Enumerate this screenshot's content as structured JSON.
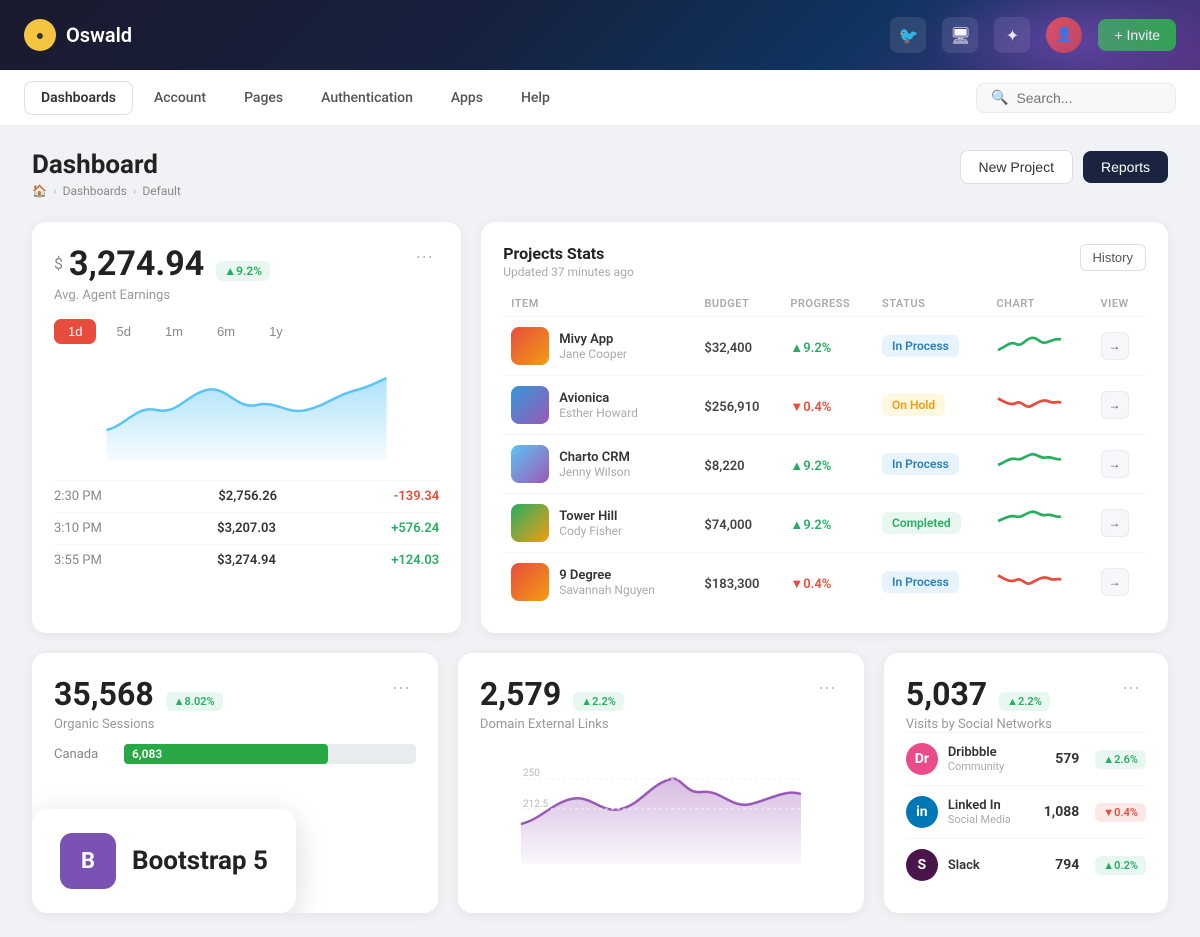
{
  "topbar": {
    "logo_icon": "●",
    "logo_text": "Oswald",
    "invite_label": "+ Invite"
  },
  "navbar": {
    "items": [
      {
        "label": "Dashboards",
        "active": true
      },
      {
        "label": "Account",
        "active": false
      },
      {
        "label": "Pages",
        "active": false
      },
      {
        "label": "Authentication",
        "active": false
      },
      {
        "label": "Apps",
        "active": false
      },
      {
        "label": "Help",
        "active": false
      }
    ],
    "search_placeholder": "Search..."
  },
  "page": {
    "title": "Dashboard",
    "breadcrumb": [
      "🏠",
      "Dashboards",
      "Default"
    ],
    "new_project_btn": "New Project",
    "reports_btn": "Reports"
  },
  "earnings": {
    "currency": "$",
    "amount": "3,274.94",
    "badge": "▲9.2%",
    "label": "Avg. Agent Earnings",
    "filters": [
      "1d",
      "5d",
      "1m",
      "6m",
      "1y"
    ],
    "active_filter": "1d",
    "rows": [
      {
        "time": "2:30 PM",
        "value": "$2,756.26",
        "change": "-139.34",
        "positive": false
      },
      {
        "time": "3:10 PM",
        "value": "$3,207.03",
        "change": "+576.24",
        "positive": true
      },
      {
        "time": "3:55 PM",
        "value": "$3,274.94",
        "change": "+124.03",
        "positive": true
      }
    ]
  },
  "projects": {
    "title": "Projects Stats",
    "updated": "Updated 37 minutes ago",
    "history_btn": "History",
    "columns": [
      "Item",
      "Budget",
      "Progress",
      "Status",
      "Chart",
      "View"
    ],
    "rows": [
      {
        "name": "Mivy App",
        "person": "Jane Cooper",
        "budget": "$32,400",
        "progress": "▲9.2%",
        "progress_up": true,
        "status": "In Process",
        "status_type": "inprocess",
        "color1": "#e74c3c",
        "color2": "#f39c12"
      },
      {
        "name": "Avionica",
        "person": "Esther Howard",
        "budget": "$256,910",
        "progress": "▼0.4%",
        "progress_up": false,
        "status": "On Hold",
        "status_type": "onhold",
        "color1": "#e74c3c",
        "color2": "#c0392b"
      },
      {
        "name": "Charto CRM",
        "person": "Jenny Wilson",
        "budget": "$8,220",
        "progress": "▲9.2%",
        "progress_up": true,
        "status": "In Process",
        "status_type": "inprocess",
        "color1": "#3498db",
        "color2": "#9b59b6"
      },
      {
        "name": "Tower Hill",
        "person": "Cody Fisher",
        "budget": "$74,000",
        "progress": "▲9.2%",
        "progress_up": true,
        "status": "Completed",
        "status_type": "completed",
        "color1": "#27ae60",
        "color2": "#2ecc71"
      },
      {
        "name": "9 Degree",
        "person": "Savannah Nguyen",
        "budget": "$183,300",
        "progress": "▼0.4%",
        "progress_up": false,
        "status": "In Process",
        "status_type": "inprocess",
        "color1": "#e74c3c",
        "color2": "#f39c12"
      }
    ]
  },
  "organic": {
    "number": "35,568",
    "badge": "▲8.02%",
    "label": "Organic Sessions",
    "canada_label": "Canada",
    "canada_value": "6,083"
  },
  "external_links": {
    "number": "2,579",
    "badge": "▲2.2%",
    "label": "Domain External Links"
  },
  "social": {
    "number": "5,037",
    "badge": "▲2.2%",
    "label": "Visits by Social Networks",
    "networks": [
      {
        "name": "Dribbble",
        "type": "Community",
        "count": "579",
        "badge": "▲2.6%",
        "positive": true,
        "bg": "#ea4c89"
      },
      {
        "name": "Linked In",
        "type": "Social Media",
        "count": "1,088",
        "badge": "▼0.4%",
        "positive": false,
        "bg": "#0077b5"
      },
      {
        "name": "Slack",
        "type": "",
        "count": "794",
        "badge": "▲0.2%",
        "positive": true,
        "bg": "#4a154b"
      }
    ]
  },
  "bootstrap": {
    "icon": "B",
    "text": "Bootstrap 5"
  }
}
